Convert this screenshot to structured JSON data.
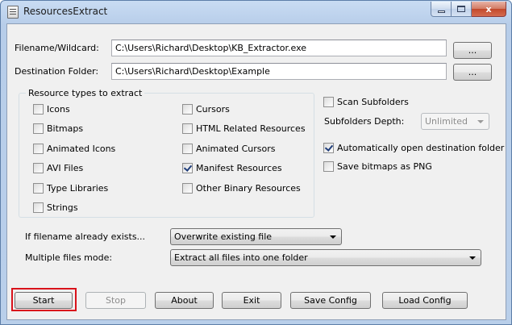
{
  "window": {
    "title": "ResourcesExtract"
  },
  "caption": {
    "close_glyph": "x"
  },
  "filename": {
    "label": "Filename/Wildcard:",
    "value": "C:\\Users\\Richard\\Desktop\\KB_Extractor.exe",
    "browse_label": "..."
  },
  "destination": {
    "label": "Destination Folder:",
    "value": "C:\\Users\\Richard\\Desktop\\Example",
    "browse_label": "..."
  },
  "resource_types": {
    "title": "Resource types to extract",
    "items": [
      {
        "label": "Icons",
        "checked": false
      },
      {
        "label": "Cursors",
        "checked": false
      },
      {
        "label": "Bitmaps",
        "checked": false
      },
      {
        "label": "HTML Related Resources",
        "checked": false
      },
      {
        "label": "Animated Icons",
        "checked": false
      },
      {
        "label": "Animated Cursors",
        "checked": false
      },
      {
        "label": "AVI Files",
        "checked": false
      },
      {
        "label": "Manifest Resources",
        "checked": true
      },
      {
        "label": "Type Libraries",
        "checked": false
      },
      {
        "label": "Other Binary Resources",
        "checked": false
      },
      {
        "label": "Strings",
        "checked": false
      }
    ]
  },
  "options": {
    "scan_subfolders": {
      "label": "Scan Subfolders",
      "checked": false
    },
    "subfolders_depth": {
      "label": "Subfolders Depth:",
      "value": "Unlimited"
    },
    "auto_open": {
      "label": "Automatically open destination folder",
      "checked": true
    },
    "save_png": {
      "label": "Save bitmaps as PNG",
      "checked": false
    }
  },
  "file_exists": {
    "label": "If filename already exists...",
    "value": "Overwrite existing file"
  },
  "multiple_files": {
    "label": "Multiple files mode:",
    "value": "Extract all files into one folder"
  },
  "buttons": {
    "start": "Start",
    "stop": "Stop",
    "about": "About",
    "exit": "Exit",
    "save_config": "Save Config",
    "load_config": "Load Config"
  }
}
